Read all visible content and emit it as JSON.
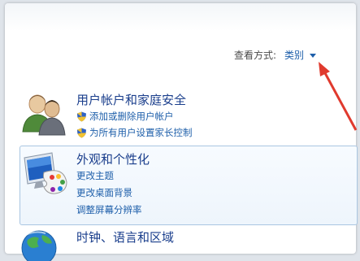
{
  "view": {
    "label": "查看方式:",
    "value": "类别"
  },
  "categories": [
    {
      "title": "用户帐户和家庭安全",
      "icon": "users-icon",
      "links": [
        "添加或删除用户帐户",
        "为所有用户设置家长控制"
      ]
    },
    {
      "title": "外观和个性化",
      "icon": "display-palette-icon",
      "links": [
        "更改主题",
        "更改桌面背景",
        "调整屏幕分辨率"
      ]
    },
    {
      "title": "时钟、语言和区域",
      "icon": "globe-icon",
      "links": []
    }
  ],
  "colors": {
    "link": "#1e5faa",
    "title": "#1a3e8c",
    "highlight_border": "#a9c6e2",
    "annotation_arrow": "#e03a2e"
  }
}
